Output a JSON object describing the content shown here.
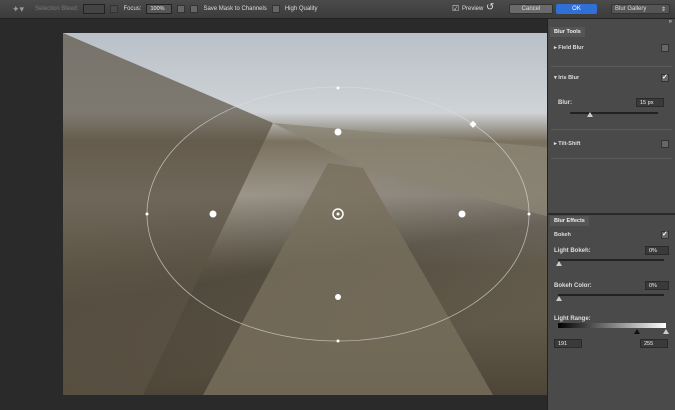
{
  "toolbar": {
    "selection_bleed_label": "Selection Bleed:",
    "selection_bleed_value": "",
    "focus_label": "Focus:",
    "focus_value": "100%",
    "save_mask_label": "Save Mask to Channels",
    "high_quality_label": "High Quality",
    "preview_label": "Preview",
    "cancel_label": "Cancel",
    "ok_label": "OK",
    "workspace_value": "Blur Gallery"
  },
  "blur_tools": {
    "tab": "Blur Tools",
    "field_blur": "Field Blur",
    "field_blur_checked": false,
    "iris_blur": "Iris Blur",
    "iris_blur_checked": true,
    "blur_label": "Blur:",
    "blur_value": "15 px",
    "blur_slider": 0.2,
    "tilt_shift": "Tilt-Shift",
    "tilt_shift_checked": false
  },
  "blur_effects": {
    "tab": "Blur Effects",
    "bokeh": "Bokeh",
    "bokeh_checked": true,
    "light_bokeh_label": "Light Bokeh:",
    "light_bokeh_value": "0%",
    "bokeh_color_label": "Bokeh Color:",
    "bokeh_color_value": "0%",
    "light_range_label": "Light Range:",
    "light_range_min": "191",
    "light_range_max": "255"
  },
  "colors": {
    "accent": "#2f6fd6"
  }
}
